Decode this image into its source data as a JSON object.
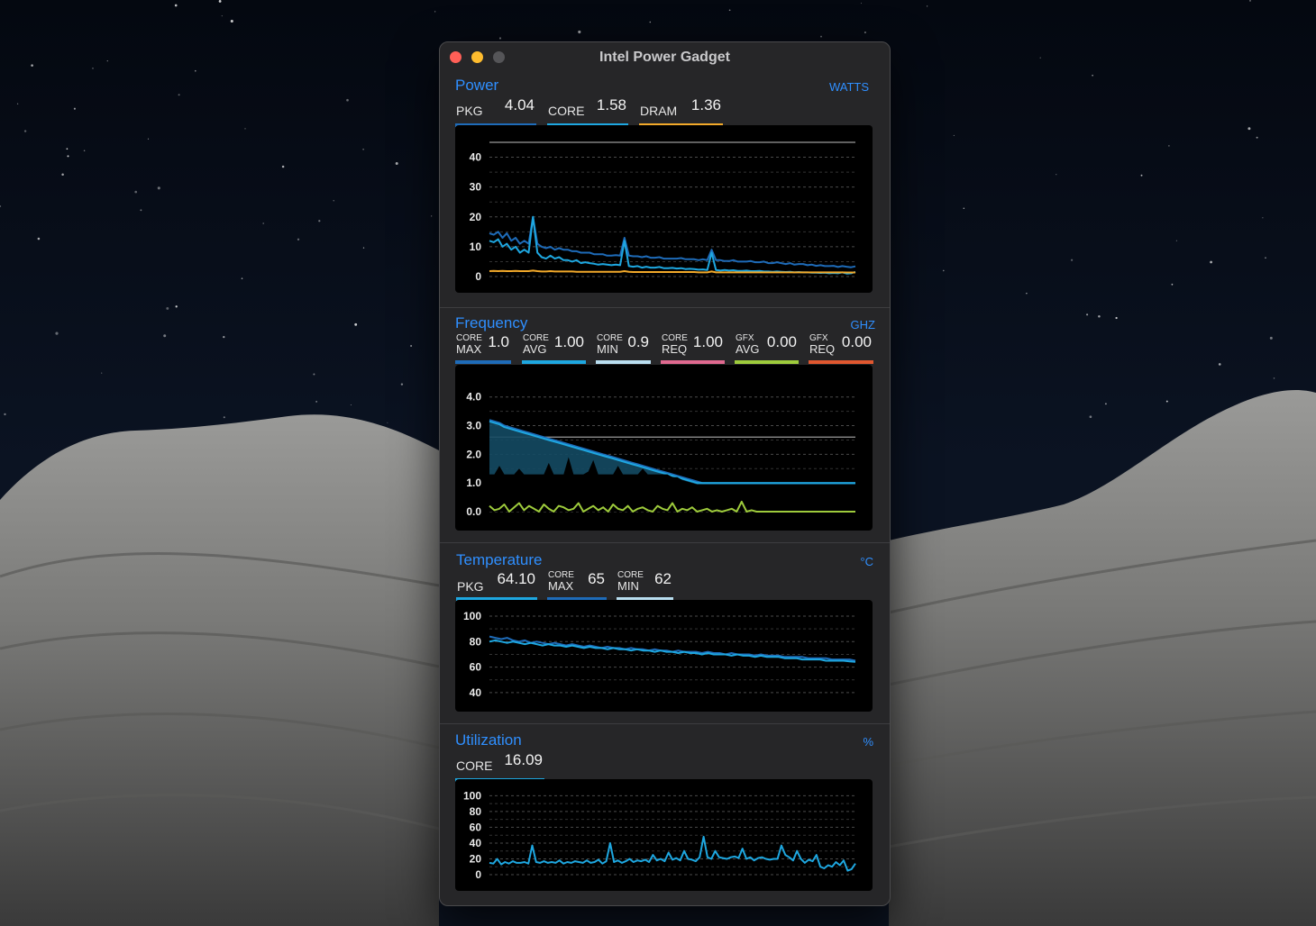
{
  "window": {
    "title": "Intel Power Gadget"
  },
  "power": {
    "title": "Power",
    "unit": "WATTS",
    "metrics": [
      {
        "label": "PKG",
        "value": "4.04",
        "color": "#1e6bb8"
      },
      {
        "label": "CORE",
        "value": "1.58",
        "color": "#1ea7e0"
      },
      {
        "label": "DRAM",
        "value": "1.36",
        "color": "#f2a92a"
      }
    ]
  },
  "frequency": {
    "title": "Frequency",
    "unit": "GHZ",
    "metrics": [
      {
        "top": "CORE",
        "bottom": "MAX",
        "value": "1.0",
        "color": "#1e6bb8"
      },
      {
        "top": "CORE",
        "bottom": "AVG",
        "value": "1.00",
        "color": "#1ea7e0"
      },
      {
        "top": "CORE",
        "bottom": "MIN",
        "value": "0.9",
        "color": "#b9def0"
      },
      {
        "top": "CORE",
        "bottom": "REQ",
        "value": "1.00",
        "color": "#e0698f"
      },
      {
        "top": "GFX",
        "bottom": "AVG",
        "value": "0.00",
        "color": "#9ecb3c"
      },
      {
        "top": "GFX",
        "bottom": "REQ",
        "value": "0.00",
        "color": "#e0572f"
      }
    ]
  },
  "temperature": {
    "title": "Temperature",
    "unit": "°C",
    "metrics": [
      {
        "label": "PKG",
        "value": "64.10",
        "color": "#1ea7e0"
      },
      {
        "top": "CORE",
        "bottom": "MAX",
        "value": "65",
        "color": "#1e6bb8"
      },
      {
        "top": "CORE",
        "bottom": "MIN",
        "value": "62",
        "color": "#b9def0"
      }
    ]
  },
  "utilization": {
    "title": "Utilization",
    "unit": "%",
    "metrics": [
      {
        "label": "CORE",
        "value": "16.09",
        "color": "#1ea7e0"
      }
    ]
  },
  "chart_data": [
    {
      "type": "line",
      "name": "power-chart",
      "yticks": [
        "0",
        "10",
        "20",
        "30",
        "40"
      ],
      "ylim": [
        0,
        45
      ],
      "grid": true,
      "reference_lines": [
        45
      ],
      "series": [
        {
          "name": "PKG",
          "color": "#1e6bb8",
          "values": [
            14.5,
            14,
            15,
            13,
            14.5,
            12,
            13,
            11,
            12,
            11,
            20,
            11,
            10,
            9.5,
            10,
            9,
            9.5,
            9,
            9,
            8.5,
            8.5,
            8,
            8,
            8,
            7.5,
            7.5,
            7.5,
            7,
            7,
            7.2,
            7,
            13,
            7,
            6.8,
            6.8,
            6.5,
            6.8,
            6.3,
            6.3,
            6.5,
            6,
            6,
            6,
            6,
            6.2,
            5.8,
            5.8,
            5.8,
            5.5,
            5.8,
            5.5,
            9,
            5.5,
            5.5,
            5.2,
            5.2,
            5.5,
            5,
            5,
            5,
            5.2,
            4.8,
            4.8,
            5,
            4.5,
            4.5,
            4.8,
            4.5,
            4.2,
            4.5,
            4,
            4.2,
            4.2,
            3.8,
            4,
            3.6,
            3.8,
            3.5,
            3.5,
            3.6,
            3.2,
            3.5,
            3.3,
            3.1,
            3.4
          ]
        },
        {
          "name": "CORE",
          "color": "#1ea7e0",
          "values": [
            12,
            11.5,
            12.5,
            10,
            11,
            9,
            10,
            8,
            9,
            8,
            20,
            8,
            6.5,
            6,
            7,
            6,
            6.5,
            5.5,
            5.5,
            5,
            5.5,
            4.5,
            4.8,
            4.5,
            4.3,
            4,
            4.2,
            4,
            3.8,
            4,
            3.8,
            12,
            3.5,
            3.3,
            3.5,
            3,
            3.3,
            3,
            3,
            3.2,
            2.8,
            2.8,
            2.9,
            2.7,
            2.8,
            2.5,
            2.6,
            2.5,
            2.3,
            2.4,
            2.2,
            8,
            2.2,
            2,
            2.2,
            2,
            2.1,
            1.9,
            1.9,
            2,
            1.8,
            1.8,
            1.9,
            1.7,
            1.7,
            1.6,
            1.7,
            1.6,
            1.5,
            1.6,
            1.4,
            1.5,
            1.4,
            1.4,
            1.3,
            1.3,
            1.2,
            1.3,
            1.1,
            1.2,
            1.1,
            1.4,
            1.0,
            1.1,
            1.58
          ]
        },
        {
          "name": "DRAM",
          "color": "#f2a92a",
          "values": [
            1.8,
            1.9,
            1.8,
            1.9,
            1.8,
            1.8,
            1.9,
            1.8,
            1.8,
            1.8,
            2,
            1.8,
            1.7,
            1.7,
            1.8,
            1.7,
            1.7,
            1.7,
            1.7,
            1.7,
            1.6,
            1.6,
            1.6,
            1.6,
            1.6,
            1.6,
            1.6,
            1.6,
            1.6,
            1.6,
            1.6,
            1.8,
            1.6,
            1.5,
            1.5,
            1.5,
            1.5,
            1.5,
            1.5,
            1.5,
            1.5,
            1.5,
            1.5,
            1.5,
            1.5,
            1.5,
            1.5,
            1.5,
            1.4,
            1.4,
            1.4,
            1.7,
            1.4,
            1.4,
            1.4,
            1.4,
            1.4,
            1.4,
            1.4,
            1.4,
            1.4,
            1.4,
            1.4,
            1.4,
            1.4,
            1.4,
            1.4,
            1.4,
            1.4,
            1.4,
            1.4,
            1.4,
            1.4,
            1.4,
            1.4,
            1.4,
            1.4,
            1.4,
            1.4,
            1.4,
            1.4,
            1.4,
            1.36,
            1.36,
            1.36
          ]
        }
      ]
    },
    {
      "type": "area",
      "name": "frequency-chart",
      "yticks": [
        "0.0",
        "1.0",
        "2.0",
        "3.0",
        "4.0"
      ],
      "ylim": [
        0,
        4.4
      ],
      "grid": true,
      "reference_lines": [
        2.6
      ],
      "series": [
        {
          "name": "CORE MAX",
          "color": "#1e6bb8",
          "fill": "#144a63",
          "values": [
            3.2,
            3.15,
            3.1,
            3.0,
            2.95,
            2.9,
            2.85,
            2.8,
            2.75,
            2.7,
            2.65,
            2.6,
            2.55,
            2.5,
            2.45,
            2.4,
            2.35,
            2.3,
            2.25,
            2.2,
            2.15,
            2.1,
            2.05,
            2.0,
            1.95,
            1.9,
            1.85,
            1.8,
            1.75,
            1.7,
            1.65,
            1.6,
            1.55,
            1.5,
            1.45,
            1.4,
            1.35,
            1.3,
            1.25,
            1.2,
            1.15,
            1.1,
            1.05,
            1.0,
            1.0,
            1.0,
            1.0,
            1.0,
            1.0,
            1.0,
            1.0,
            1.0,
            1.0,
            1.0,
            1.0,
            1.0,
            1.0,
            1.0,
            1.0,
            1.0,
            1.0,
            1.0,
            1.0,
            1.0,
            1.0,
            1.0,
            1.0,
            1.0,
            1.0,
            1.0,
            1.0,
            1.0,
            1.0,
            1.0,
            1.0
          ]
        },
        {
          "name": "CORE AVG",
          "color": "#1ea7e0",
          "values": [
            3.15,
            3.1,
            3.05,
            2.95,
            2.9,
            2.85,
            2.8,
            2.75,
            2.7,
            2.65,
            2.6,
            2.55,
            2.5,
            2.45,
            2.4,
            2.35,
            2.3,
            2.25,
            2.2,
            2.15,
            2.1,
            2.05,
            2.0,
            1.95,
            1.9,
            1.85,
            1.8,
            1.75,
            1.7,
            1.65,
            1.6,
            1.55,
            1.5,
            1.45,
            1.4,
            1.35,
            1.3,
            1.25,
            1.2,
            1.15,
            1.1,
            1.05,
            1.0,
            1.0,
            1.0,
            1.0,
            1.0,
            1.0,
            1.0,
            1.0,
            1.0,
            1.0,
            1.0,
            1.0,
            1.0,
            1.0,
            1.0,
            1.0,
            1.0,
            1.0,
            1.0,
            1.0,
            1.0,
            1.0,
            1.0,
            1.0,
            1.0,
            1.0,
            1.0,
            1.0,
            1.0,
            1.0,
            1.0,
            1.0,
            1.0
          ]
        },
        {
          "name": "CORE MIN",
          "color": "#0a0f14",
          "values": [
            1.3,
            1.3,
            1.6,
            1.3,
            1.3,
            1.3,
            1.5,
            1.3,
            1.3,
            1.3,
            1.3,
            1.3,
            1.7,
            1.3,
            1.3,
            1.3,
            1.9,
            1.3,
            1.3,
            1.3,
            1.4,
            1.8,
            1.3,
            1.3,
            1.3,
            1.3,
            1.6,
            1.3,
            1.3,
            1.3,
            1.3,
            1.5,
            1.3,
            1.3,
            1.3,
            1.3,
            1.3,
            1.2,
            1.2,
            1.1,
            1.05,
            1.0,
            0.95,
            0.95,
            0.95,
            0.95,
            0.95,
            0.95,
            0.95,
            0.95,
            0.95,
            0.95,
            0.95,
            0.95,
            0.95,
            0.95,
            0.95,
            0.95,
            0.95,
            0.95,
            0.95,
            0.95,
            0.95,
            0.95,
            0.95,
            0.95,
            0.95,
            0.95,
            0.95,
            0.95,
            0.95,
            0.95,
            0.95,
            0.95,
            0.95
          ]
        },
        {
          "name": "GFX AVG",
          "color": "#9ecb3c",
          "values": [
            0.2,
            0.05,
            0.1,
            0.25,
            0.0,
            0.15,
            0.3,
            0.05,
            0.2,
            0.1,
            0.0,
            0.25,
            0.1,
            0.0,
            0.2,
            0.15,
            0.05,
            0.1,
            0.3,
            0.0,
            0.1,
            0.2,
            0.05,
            0.15,
            0.0,
            0.25,
            0.1,
            0.05,
            0.2,
            0.0,
            0.1,
            0.15,
            0.05,
            0.0,
            0.2,
            0.1,
            0.05,
            0.3,
            0.0,
            0.1,
            0.05,
            0.15,
            0.0,
            0.05,
            0.1,
            0.0,
            0.05,
            0.0,
            0.05,
            0.1,
            0.0,
            0.35,
            0.0,
            0.05,
            0.0,
            0.0,
            0.0,
            0.0,
            0.0,
            0.0,
            0.0,
            0.0,
            0.0,
            0.0,
            0.0,
            0.0,
            0.0,
            0.0,
            0.0,
            0.0,
            0.0,
            0.0,
            0.0,
            0.0,
            0.0
          ]
        }
      ]
    },
    {
      "type": "line",
      "name": "temperature-chart",
      "yticks": [
        "40",
        "60",
        "80",
        "100"
      ],
      "ylim": [
        35,
        100
      ],
      "grid": true,
      "series": [
        {
          "name": "CORE MAX",
          "color": "#1e6bb8",
          "values": [
            84,
            83,
            82,
            83,
            81,
            80,
            81,
            79,
            80,
            79,
            78,
            79,
            78,
            77,
            78,
            77,
            76,
            77,
            76,
            75,
            76,
            75,
            75,
            74,
            75,
            74,
            74,
            73,
            74,
            73,
            73,
            72,
            73,
            72,
            72,
            72,
            71,
            72,
            71,
            71,
            70,
            71,
            70,
            70,
            70,
            69,
            70,
            69,
            69,
            69,
            68,
            68,
            68,
            68,
            67,
            67,
            67,
            67,
            66,
            66,
            66,
            66,
            65
          ]
        },
        {
          "name": "PKG",
          "color": "#1ea7e0",
          "values": [
            80,
            81,
            80,
            79,
            80,
            79,
            78,
            79,
            78,
            77,
            78,
            77,
            77,
            76,
            77,
            76,
            75,
            76,
            75,
            75,
            74,
            75,
            74,
            74,
            73,
            74,
            73,
            73,
            72,
            73,
            72,
            72,
            71,
            72,
            71,
            71,
            70,
            71,
            70,
            70,
            70,
            69,
            70,
            69,
            69,
            68,
            69,
            68,
            68,
            68,
            67,
            67,
            67,
            66,
            66,
            66,
            66,
            65,
            65,
            65,
            65,
            64.5,
            64.1
          ]
        }
      ]
    },
    {
      "type": "line",
      "name": "utilization-chart",
      "yticks": [
        "0",
        "20",
        "40",
        "60",
        "80",
        "100"
      ],
      "ylim": [
        0,
        105
      ],
      "grid": true,
      "series": [
        {
          "name": "CORE",
          "color": "#1ea7e0",
          "values": [
            15,
            14,
            20,
            13,
            16,
            14,
            17,
            15,
            15,
            16,
            14,
            37,
            16,
            15,
            17,
            15,
            16,
            15,
            18,
            14,
            16,
            15,
            17,
            16,
            15,
            18,
            15,
            16,
            19,
            14,
            17,
            40,
            16,
            18,
            15,
            17,
            20,
            16,
            18,
            17,
            19,
            16,
            25,
            18,
            20,
            17,
            28,
            19,
            21,
            18,
            30,
            20,
            19,
            17,
            22,
            48,
            22,
            20,
            30,
            22,
            21,
            20,
            22,
            23,
            21,
            33,
            20,
            22,
            18,
            21,
            22,
            20,
            19,
            20,
            20,
            37,
            25,
            22,
            18,
            30,
            20,
            15,
            19,
            17,
            25,
            10,
            8,
            12,
            10,
            16,
            12,
            18,
            5,
            7,
            14
          ]
        }
      ]
    }
  ]
}
